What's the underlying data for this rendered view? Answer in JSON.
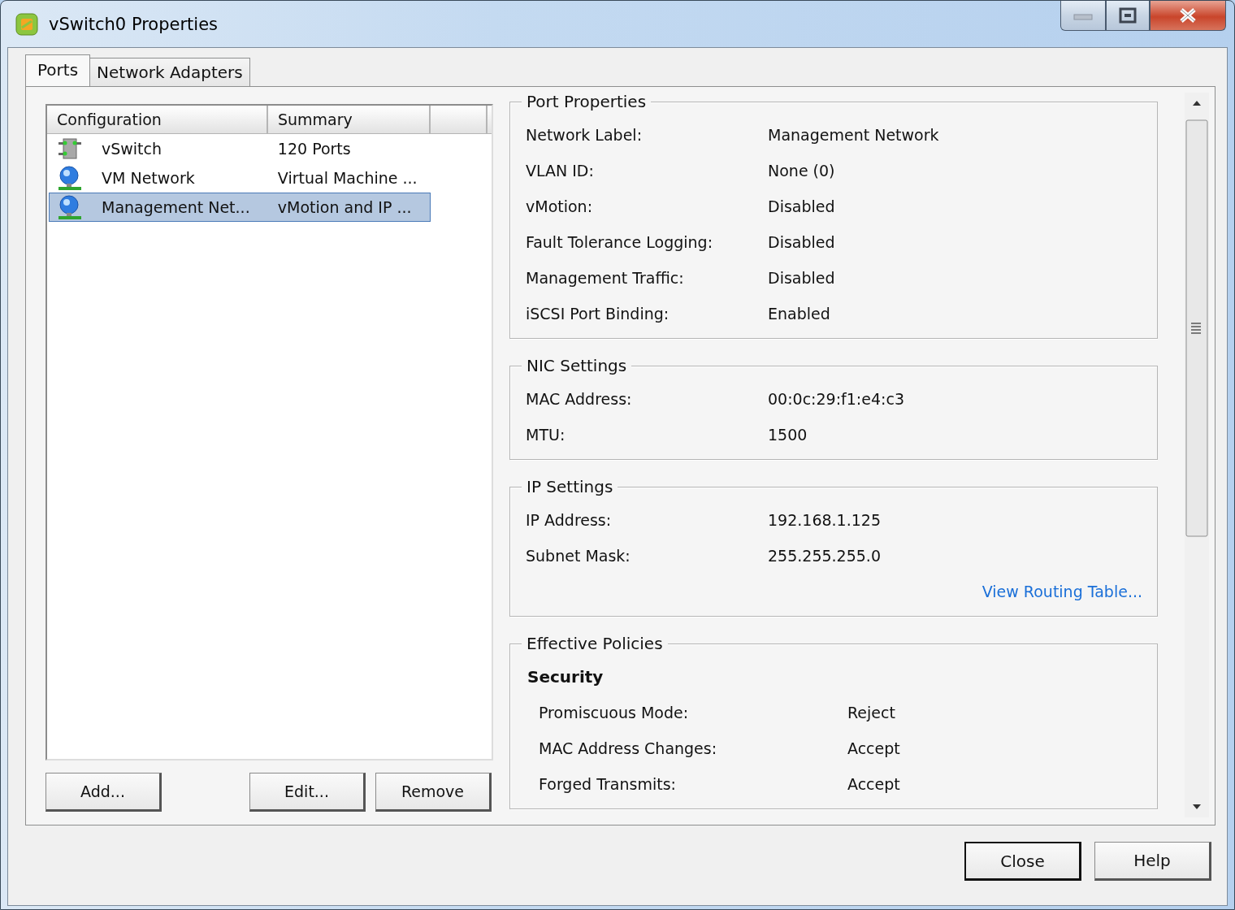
{
  "window": {
    "title": "vSwitch0 Properties"
  },
  "tabs": [
    {
      "label": "Ports",
      "selected": true
    },
    {
      "label": "Network Adapters",
      "selected": false
    }
  ],
  "ports_table": {
    "columns": [
      "Configuration",
      "Summary"
    ],
    "rows": [
      {
        "kind": "switch",
        "configuration": "vSwitch",
        "summary": "120 Ports",
        "selected": false
      },
      {
        "kind": "portgroup",
        "configuration": "VM Network",
        "summary": "Virtual Machine ...",
        "selected": false
      },
      {
        "kind": "portgroup",
        "configuration": "Management Net...",
        "summary": "vMotion and IP ...",
        "selected": true
      }
    ]
  },
  "list_buttons": [
    "Add...",
    "Edit...",
    "Remove"
  ],
  "groups": [
    {
      "title": "Port Properties",
      "rows": [
        {
          "label": "Network Label:",
          "value": "Management Network"
        },
        {
          "label": "VLAN ID:",
          "value": "None (0)"
        },
        {
          "label": "vMotion:",
          "value": "Disabled"
        },
        {
          "label": "Fault Tolerance Logging:",
          "value": "Disabled"
        },
        {
          "label": "Management Traffic:",
          "value": "Disabled"
        },
        {
          "label": "iSCSI Port Binding:",
          "value": "Enabled"
        }
      ]
    },
    {
      "title": "NIC Settings",
      "rows": [
        {
          "label": "MAC Address:",
          "value": "00:0c:29:f1:e4:c3"
        },
        {
          "label": "MTU:",
          "value": "1500"
        }
      ]
    },
    {
      "title": "IP Settings",
      "rows": [
        {
          "label": "IP Address:",
          "value": "192.168.1.125"
        },
        {
          "label": "Subnet Mask:",
          "value": "255.255.255.0"
        }
      ],
      "link": "View Routing Table..."
    },
    {
      "title": "Effective Policies",
      "section": "Security",
      "rows": [
        {
          "label": "Promiscuous Mode:",
          "value": "Reject"
        },
        {
          "label": "MAC Address Changes:",
          "value": "Accept"
        },
        {
          "label": "Forged Transmits:",
          "value": "Accept"
        }
      ]
    }
  ],
  "buttons": [
    {
      "label": "Close",
      "default": true
    },
    {
      "label": "Help",
      "default": false
    }
  ]
}
